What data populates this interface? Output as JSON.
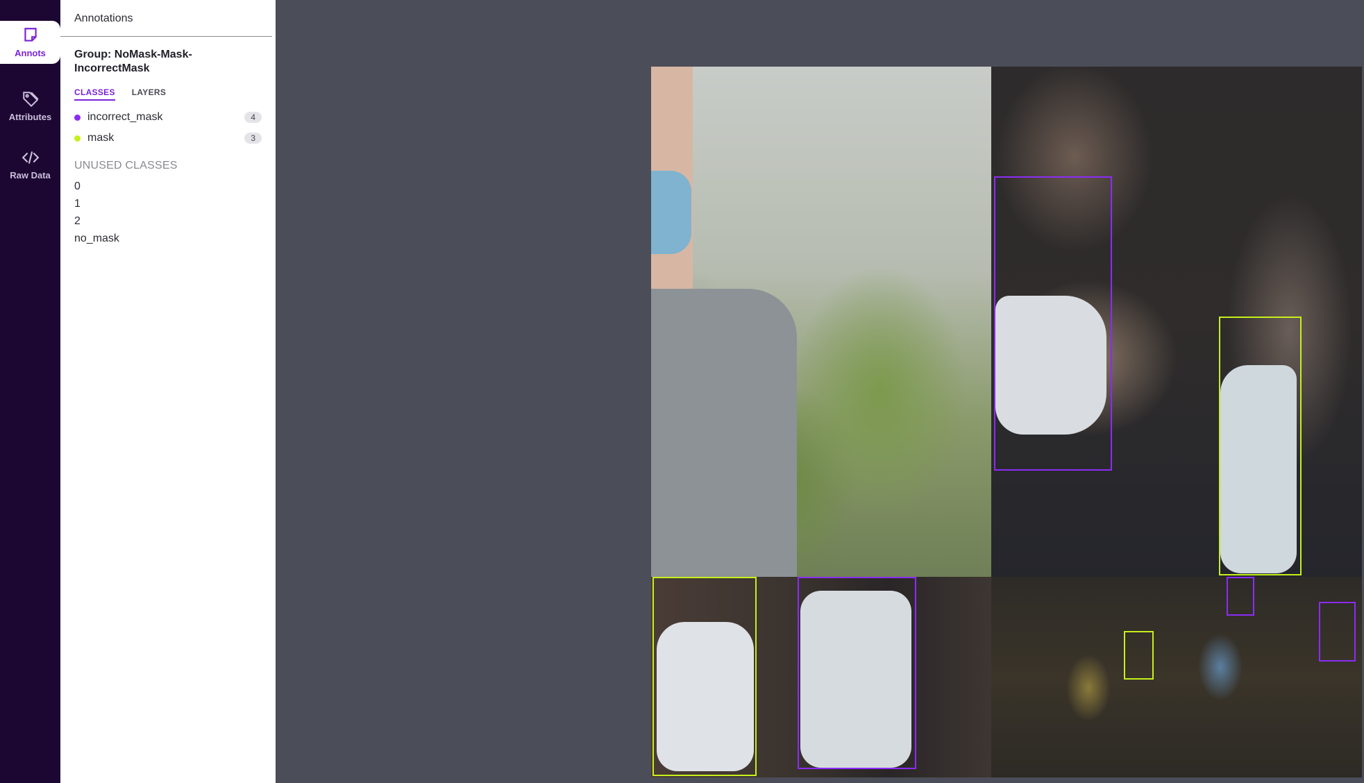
{
  "rail": {
    "items": [
      {
        "label": "Annots",
        "icon": "sticky-note-icon"
      },
      {
        "label": "Attributes",
        "icon": "tag-icon"
      },
      {
        "label": "Raw Data",
        "icon": "code-icon"
      }
    ]
  },
  "panel": {
    "header": "Annotations",
    "group_title": "Group: NoMask-Mask-IncorrectMask",
    "tabs": [
      "CLASSES",
      "LAYERS"
    ],
    "active_tab": "CLASSES",
    "classes": [
      {
        "name": "incorrect_mask",
        "count": "4",
        "color": "#8b2cf5"
      },
      {
        "name": "mask",
        "count": "3",
        "color": "#c6f01b"
      }
    ],
    "unused_title": "UNUSED CLASSES",
    "unused": [
      "0",
      "1",
      "2",
      "no_mask"
    ]
  },
  "canvas": {
    "background": "#4b4e58",
    "annotations": [
      {
        "class": "incorrect_mask"
      },
      {
        "class": "mask"
      },
      {
        "class": "mask"
      },
      {
        "class": "incorrect_mask"
      },
      {
        "class": "incorrect_mask"
      },
      {
        "class": "mask"
      },
      {
        "class": "incorrect_mask"
      }
    ]
  }
}
